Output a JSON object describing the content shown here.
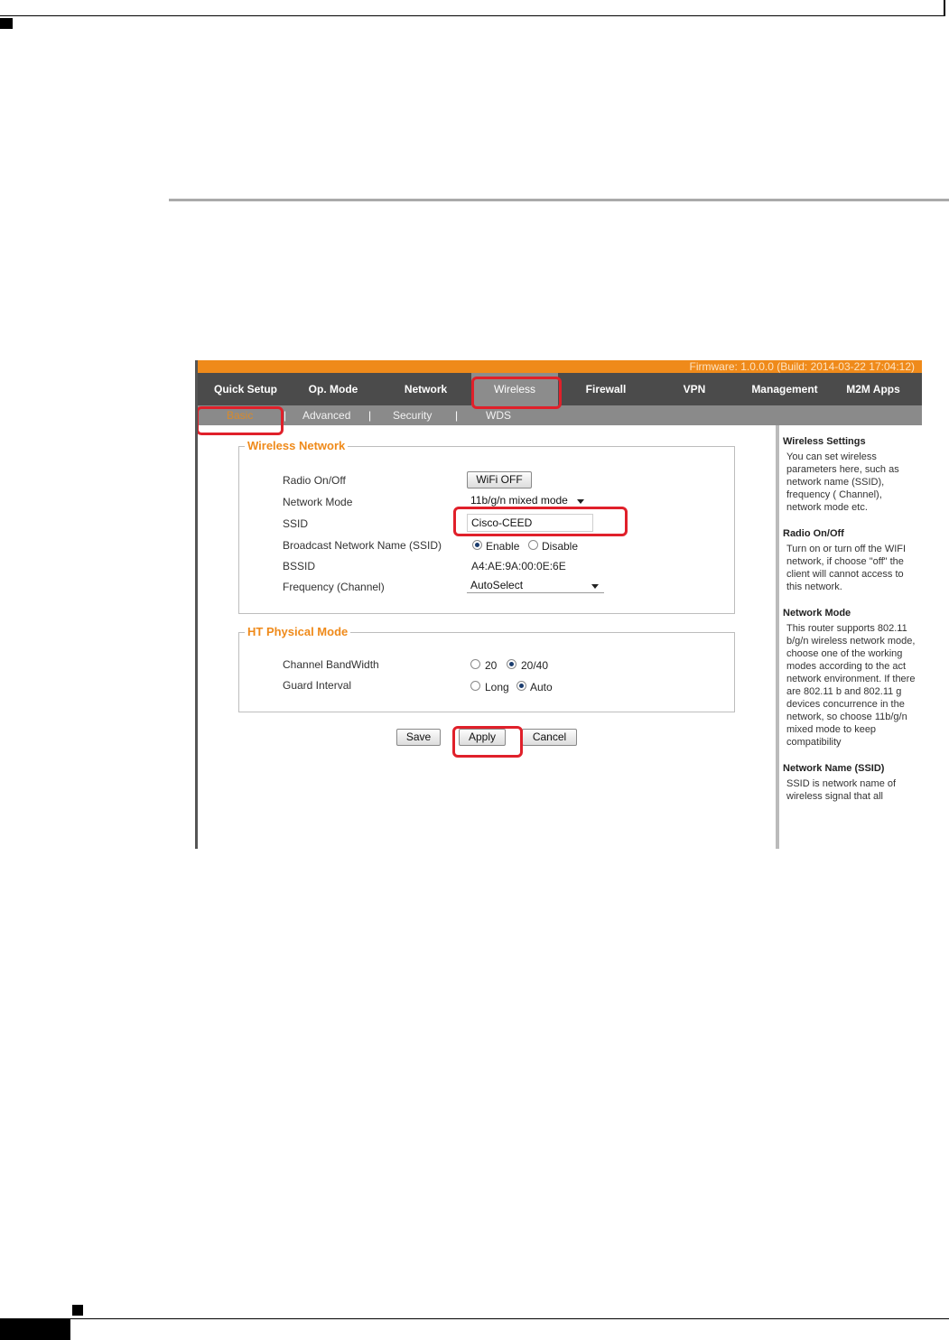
{
  "colors": {
    "accent_orange": "#ef8a1a",
    "nav_dark": "#4b4b4b",
    "nav_active": "#8c8c8c",
    "highlight_red": "#e0202a"
  },
  "firmware_text": "Firmware: 1.0.0.0 (Build: 2014-03-22 17:04:12)",
  "main_nav": [
    "Quick Setup",
    "Op. Mode",
    "Network",
    "Wireless",
    "Firewall",
    "VPN",
    "Management",
    "M2M Apps"
  ],
  "sub_nav": {
    "items": [
      "Basic",
      "Advanced",
      "Security",
      "WDS"
    ],
    "separator": "|"
  },
  "wireless_network": {
    "legend": "Wireless Network",
    "radio_label": "Radio On/Off",
    "radio_button": "WiFi OFF",
    "mode_label": "Network Mode",
    "mode_value": "11b/g/n mixed mode",
    "ssid_label": "SSID",
    "ssid_value": "Cisco-CEED",
    "broadcast_label": "Broadcast Network Name (SSID)",
    "broadcast_enable": "Enable",
    "broadcast_disable": "Disable",
    "bssid_label": "BSSID",
    "bssid_value": "A4:AE:9A:00:0E:6E",
    "freq_label": "Frequency (Channel)",
    "freq_value": "AutoSelect"
  },
  "ht_mode": {
    "legend": "HT Physical Mode",
    "bw_label": "Channel BandWidth",
    "bw_20": "20",
    "bw_2040": "20/40",
    "gi_label": "Guard Interval",
    "gi_long": "Long",
    "gi_auto": "Auto"
  },
  "actions": {
    "save": "Save",
    "apply": "Apply",
    "cancel": "Cancel"
  },
  "help": [
    {
      "title": "Wireless Settings",
      "body": "You can set wireless parameters here, such as network name (SSID), frequency ( Channel), network mode etc."
    },
    {
      "title": "Radio On/Off",
      "body": "Turn on or turn off the WIFI network, if choose \"off\" the client will cannot access to this network."
    },
    {
      "title": "Network Mode",
      "body": "This router supports 802.11 b/g/n wireless network mode, choose one of the working modes according to the act network environment. If there are 802.11 b and 802.11 g devices concurrence in the network, so choose 11b/g/n mixed mode to keep compatibility"
    },
    {
      "title": "Network Name (SSID)",
      "body": "SSID is network name of wireless signal that all"
    }
  ]
}
